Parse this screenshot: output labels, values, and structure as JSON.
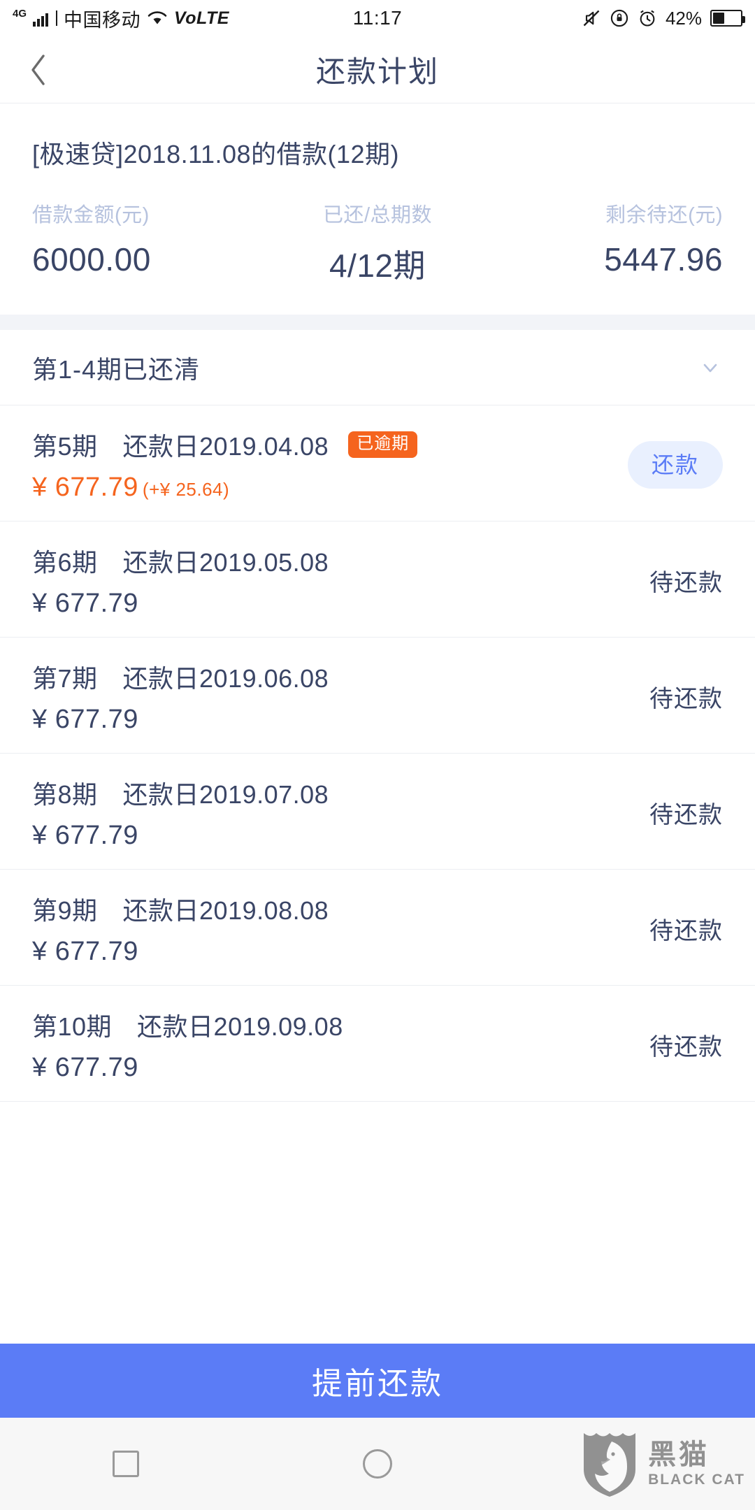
{
  "status_bar": {
    "network_type": "4G",
    "carrier": "中国移动",
    "volte": "VoLTE",
    "time": "11:17",
    "battery_percent": "42%",
    "battery_level": 42,
    "icons": [
      "signal-bars-icon",
      "wifi-icon",
      "mute-icon",
      "rotation-lock-icon",
      "alarm-icon",
      "battery-icon"
    ]
  },
  "header": {
    "title": "还款计划",
    "back_icon": "chevron-left-icon"
  },
  "summary": {
    "loan_title": "[极速贷]2018.11.08的借款(12期)",
    "columns": [
      {
        "label": "借款金额(元)",
        "value": "6000.00"
      },
      {
        "label": "已还/总期数",
        "value": "4/12期"
      },
      {
        "label": "剩余待还(元)",
        "value": "5447.96"
      }
    ]
  },
  "paid_section": {
    "label": "第1-4期已还清",
    "expand_icon": "chevron-down-icon"
  },
  "installments": [
    {
      "period": "第5期",
      "date_label": "还款日2019.04.08",
      "amount": "¥ 677.79",
      "extra": "(+¥ 25.64)",
      "badge": "已逾期",
      "action": "还款",
      "status": "",
      "overdue": true
    },
    {
      "period": "第6期",
      "date_label": "还款日2019.05.08",
      "amount": "¥ 677.79",
      "extra": "",
      "badge": "",
      "action": "",
      "status": "待还款",
      "overdue": false
    },
    {
      "period": "第7期",
      "date_label": "还款日2019.06.08",
      "amount": "¥ 677.79",
      "extra": "",
      "badge": "",
      "action": "",
      "status": "待还款",
      "overdue": false
    },
    {
      "period": "第8期",
      "date_label": "还款日2019.07.08",
      "amount": "¥ 677.79",
      "extra": "",
      "badge": "",
      "action": "",
      "status": "待还款",
      "overdue": false
    },
    {
      "period": "第9期",
      "date_label": "还款日2019.08.08",
      "amount": "¥ 677.79",
      "extra": "",
      "badge": "",
      "action": "",
      "status": "待还款",
      "overdue": false
    },
    {
      "period": "第10期",
      "date_label": "还款日2019.09.08",
      "amount": "¥ 677.79",
      "extra": "",
      "badge": "",
      "action": "",
      "status": "待还款",
      "overdue": false
    }
  ],
  "cta": {
    "label": "提前还款"
  },
  "system_nav": {
    "recents_icon": "square-icon",
    "home_icon": "circle-icon"
  },
  "watermark": {
    "cn": "黑猫",
    "en": "BLACK CAT",
    "logo_icon": "black-cat-shield-icon"
  },
  "colors": {
    "accent_blue": "#5b7cf6",
    "text_navy": "#3a4566",
    "label_muted": "#b6c2de",
    "overdue_orange": "#f5641e",
    "divider": "#eceef2",
    "band": "#f2f4f8"
  }
}
